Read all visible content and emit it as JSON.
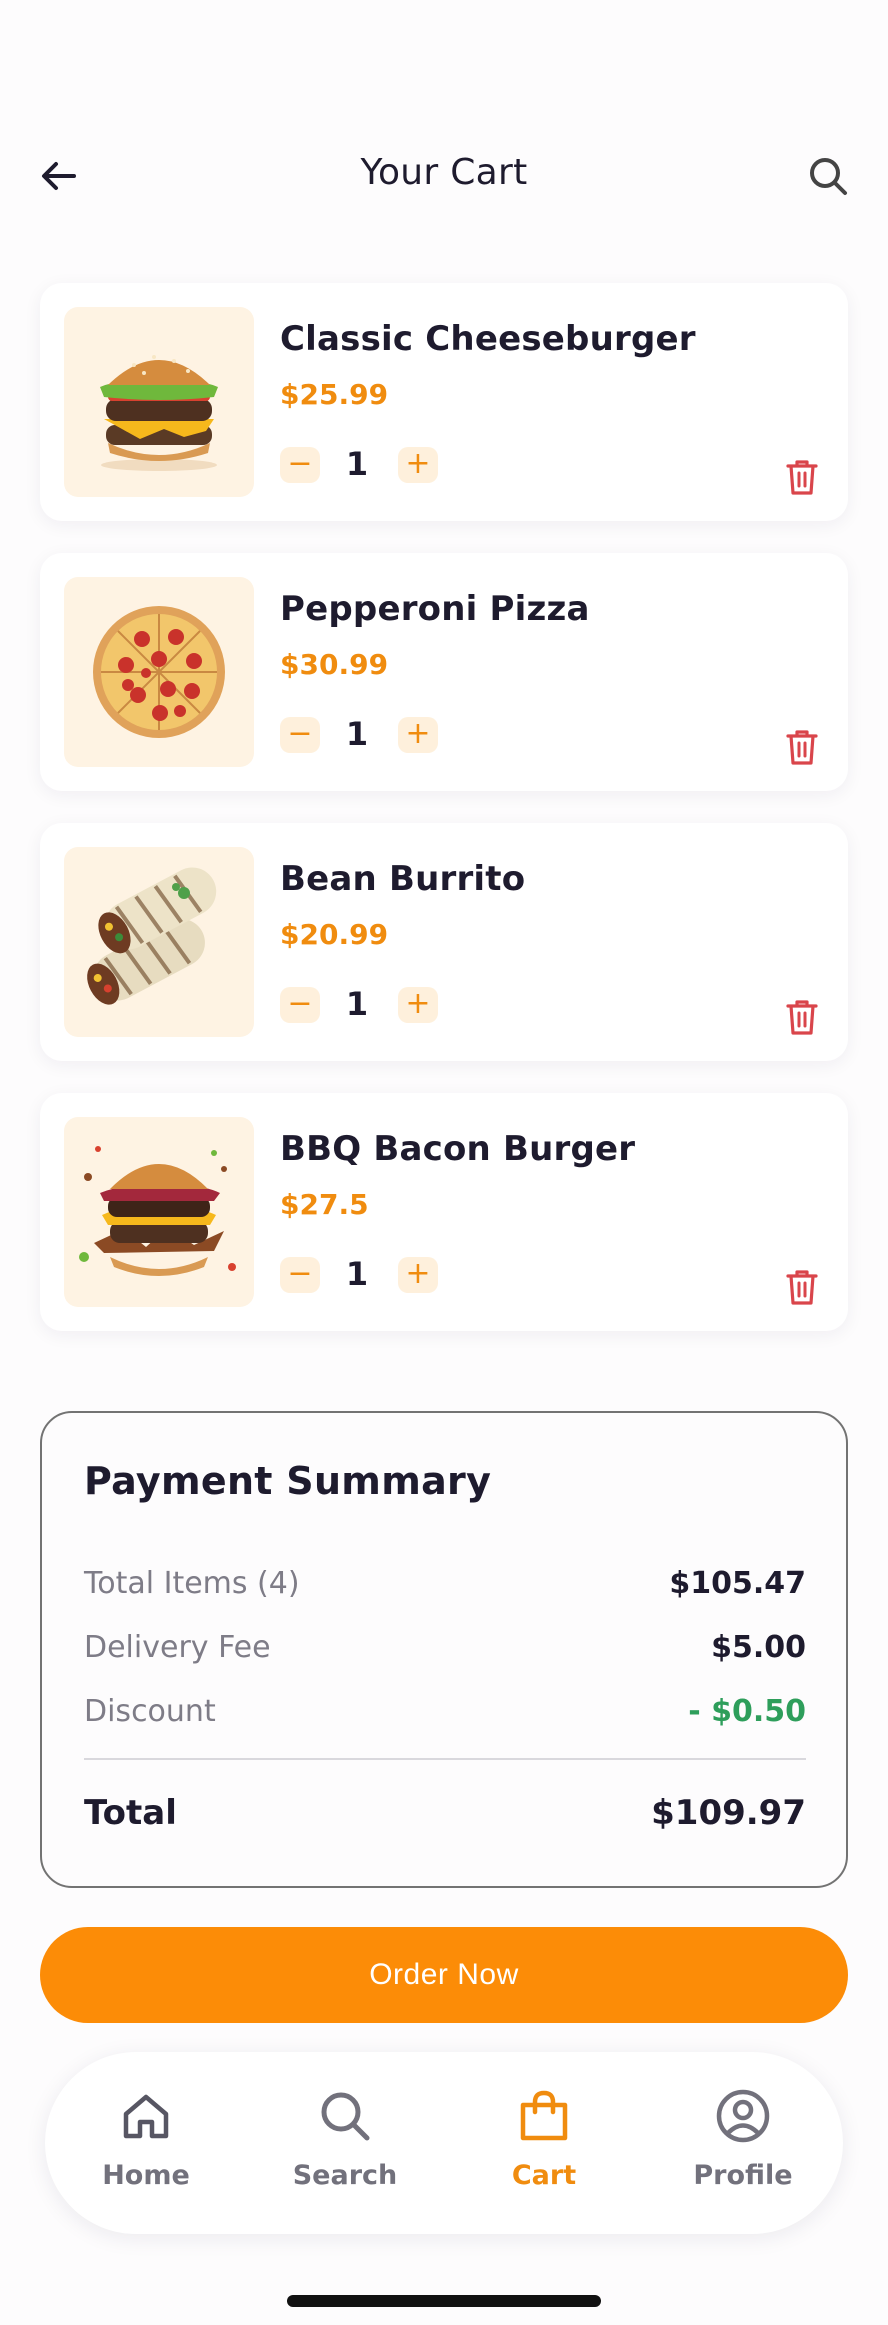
{
  "header": {
    "title": "Your Cart"
  },
  "cart": {
    "items": [
      {
        "name": "Classic Cheeseburger",
        "price": "$25.99",
        "quantity": "1",
        "image": "cheeseburger"
      },
      {
        "name": "Pepperoni Pizza",
        "price": "$30.99",
        "quantity": "1",
        "image": "pepperoni-pizza"
      },
      {
        "name": "Bean Burrito",
        "price": "$20.99",
        "quantity": "1",
        "image": "bean-burrito"
      },
      {
        "name": "BBQ Bacon Burger",
        "price": "$27.5",
        "quantity": "1",
        "image": "bbq-bacon-burger"
      }
    ],
    "minus_symbol": "−",
    "plus_symbol": "+"
  },
  "summary": {
    "title": "Payment Summary",
    "rows": [
      {
        "label": "Total Items (4)",
        "value": "$105.47"
      },
      {
        "label": "Delivery Fee",
        "value": "$5.00"
      },
      {
        "label": "Discount",
        "value": "- $0.50"
      }
    ],
    "total_label": "Total",
    "total_value": "$109.97"
  },
  "order_button": {
    "label": "Order Now"
  },
  "tabbar": {
    "tabs": [
      {
        "label": "Home",
        "icon": "home-icon",
        "active": false
      },
      {
        "label": "Search",
        "icon": "search-icon",
        "active": false
      },
      {
        "label": "Cart",
        "icon": "bag-icon",
        "active": true
      },
      {
        "label": "Profile",
        "icon": "profile-icon",
        "active": false
      }
    ]
  },
  "colors": {
    "accent": "#FC8C07",
    "price": "#F08C0F",
    "discount": "#2E9E5B",
    "delete": "#D9454B",
    "text": "#1E1B2E",
    "muted": "#7E7C87"
  }
}
